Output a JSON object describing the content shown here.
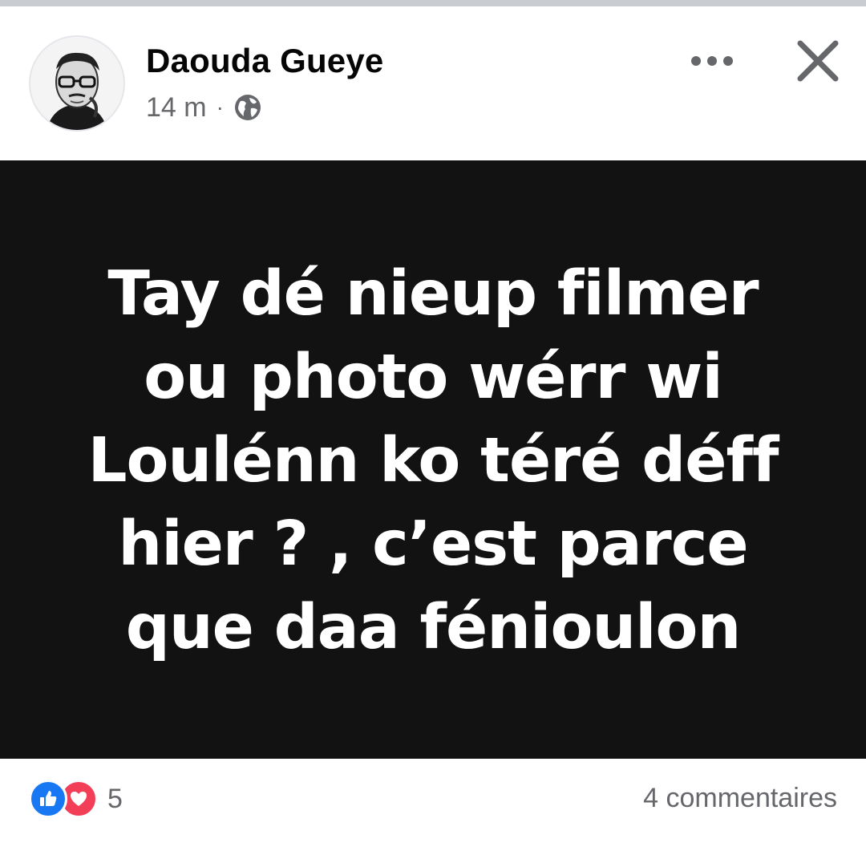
{
  "post": {
    "author_name": "Daouda Gueye",
    "timestamp": "14 m",
    "separator": "·",
    "privacy_icon": "globe-icon",
    "menu_icon": "more-horizontal-icon",
    "close_icon": "close-icon",
    "body_lines": [
      "Tay dé nieup filmer",
      "ou photo wérr wi",
      "Loulénn ko téré déff",
      "hier ? , c’est parce",
      "que daa fénioulon"
    ],
    "background_color": "#121212",
    "text_color": "#ffffff"
  },
  "footer": {
    "reaction_icons": [
      "like-icon",
      "love-icon"
    ],
    "reaction_count": "5",
    "comments_label": "4 commentaires"
  },
  "colors": {
    "accent_blue": "#1877f2",
    "love_red": "#f33e58",
    "secondary_text": "#65676b"
  }
}
